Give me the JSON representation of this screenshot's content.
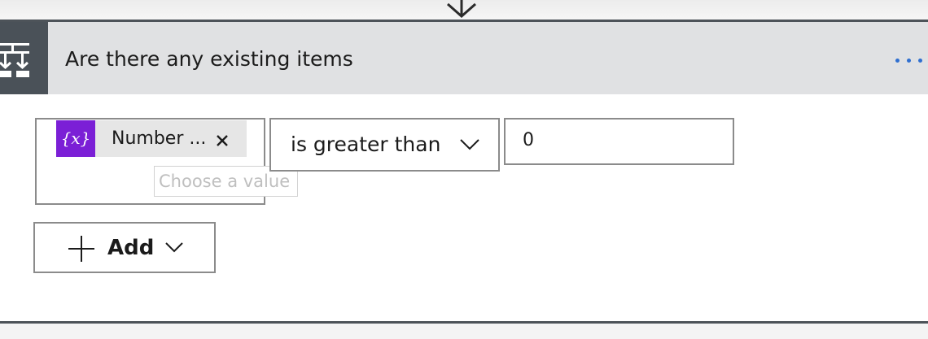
{
  "card": {
    "title": "Are there any existing items",
    "icon": "condition-icon",
    "more_icon": "more-options-icon"
  },
  "condition": {
    "left_token": {
      "icon": "variable-icon",
      "icon_text": "{x}",
      "label": "Number ...",
      "remove_icon": "close-icon"
    },
    "left_placeholder": "Choose a value",
    "operator": "is greater than",
    "right_value": "0"
  },
  "add_button": {
    "label": "Add"
  },
  "colors": {
    "header_bg": "#e0e1e3",
    "icon_box_bg": "#4a5158",
    "token_icon_bg": "#7b1fd6",
    "accent_dots": "#2f6fd0"
  }
}
